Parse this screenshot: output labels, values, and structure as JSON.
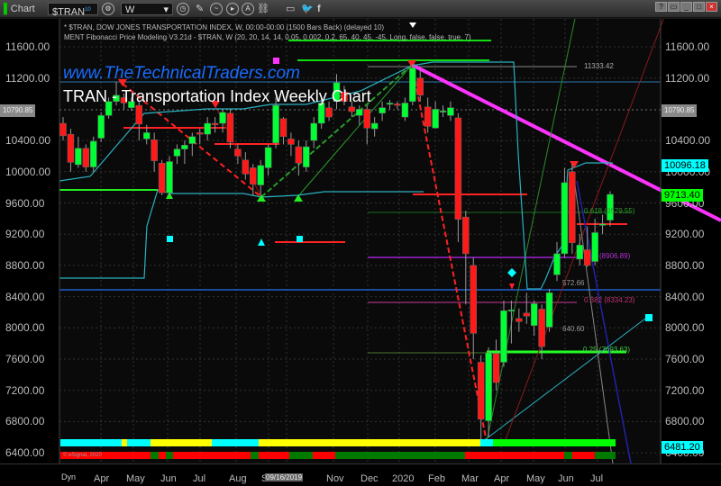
{
  "toolbar": {
    "app_label": "Chart",
    "symbol": "$TRAN",
    "symbol_badge": "10",
    "interval": "W",
    "help": "?"
  },
  "legend": {
    "line1": "* $TRAN, DOW JONES TRANSPORTATION INDEX, W, 00:00-00:00 (1500 Bars Back) (delayed 10)",
    "line2": "MENT Fibonacci Price Modeling V3.21d - $TRAN, W (20, 20, 14, 14, 0.05, 0.002, 0.2, 65, 40, 45, -45, Long, false, false, true, 7)"
  },
  "watermark": "www.TheTechnicalTraders.com",
  "title": "TRAN - Transportation Index Weekly Chart",
  "price_axis": [
    "11600.00",
    "11200.00",
    "10400.00",
    "10000.00",
    "9600.00",
    "9200.00",
    "8800.00",
    "8400.00",
    "8000.00",
    "7600.00",
    "7200.00",
    "6800.00",
    "6400.00"
  ],
  "left_axis": [
    "11600.00",
    "11200.00",
    "10400.00",
    "10000.00",
    "9600.00",
    "9200.00",
    "8800.00",
    "8400.00",
    "8000.00",
    "7600.00",
    "7200.00",
    "6800.00",
    "6400.00"
  ],
  "tags": {
    "last_gray": "10790.85",
    "cyan_high": "10096.18",
    "last_price": "9713.40",
    "cyan_low": "6481.20"
  },
  "annotations": {
    "high": "11333.42",
    "fib618": "0.618 (9579.55)",
    "fib50": "(8906.89)",
    "fib382": "0.382 (8334.23)",
    "fib25": "0.25 (7693.63)",
    "val1": "572.66",
    "val2": "640.60"
  },
  "copyright": "© eSignal, 2020",
  "time_axis": {
    "dyn": "Dyn",
    "months": [
      "Apr",
      "May",
      "Jun",
      "Jul",
      "Aug",
      "S",
      "ct",
      "Nov",
      "Dec",
      "2020",
      "Feb",
      "Mar",
      "Apr",
      "May",
      "Jun",
      "Jul"
    ],
    "cursor_date": "09/16/2019"
  },
  "colors": {
    "up": "#00ff33",
    "down": "#ff1a1a",
    "trend": "#ff33ff",
    "cyan": "#00ffff"
  },
  "chart_data": {
    "type": "candlestick",
    "ylim": [
      6400,
      11700
    ],
    "candles": [
      [
        10620,
        10700,
        10400,
        10460
      ],
      [
        10480,
        10550,
        10000,
        10120
      ],
      [
        10090,
        10450,
        10050,
        10300
      ],
      [
        10300,
        10350,
        10000,
        10060
      ],
      [
        10060,
        10450,
        10000,
        10390
      ],
      [
        10430,
        10760,
        10380,
        10720
      ],
      [
        10720,
        10950,
        10680,
        10900
      ],
      [
        10900,
        11150,
        10850,
        10980
      ],
      [
        10950,
        11000,
        10800,
        10880
      ],
      [
        10820,
        10950,
        10780,
        10900
      ],
      [
        10850,
        10900,
        10400,
        10610
      ],
      [
        10420,
        10600,
        10350,
        10500
      ],
      [
        10410,
        10500,
        10000,
        10140
      ],
      [
        10110,
        10150,
        9700,
        9730
      ],
      [
        9730,
        10200,
        9700,
        10130
      ],
      [
        10200,
        10350,
        10100,
        10290
      ],
      [
        10290,
        10400,
        10100,
        10340
      ],
      [
        10360,
        10500,
        10200,
        10450
      ],
      [
        10500,
        10550,
        10350,
        10480
      ],
      [
        10480,
        10700,
        10400,
        10620
      ],
      [
        10620,
        10700,
        10500,
        10600
      ],
      [
        10620,
        10800,
        10500,
        10760
      ],
      [
        10750,
        10800,
        10300,
        10380
      ],
      [
        10290,
        10350,
        10100,
        10200
      ],
      [
        10150,
        10250,
        9900,
        9970
      ],
      [
        10050,
        10100,
        9700,
        9840
      ],
      [
        9830,
        10150,
        9700,
        10080
      ],
      [
        10050,
        10350,
        9950,
        10310
      ],
      [
        10370,
        10950,
        10300,
        10850
      ],
      [
        10680,
        10700,
        10350,
        10450
      ],
      [
        10420,
        10500,
        10200,
        10350
      ],
      [
        10320,
        10400,
        9950,
        10110
      ],
      [
        10060,
        10400,
        10000,
        10320
      ],
      [
        10400,
        10700,
        10300,
        10620
      ],
      [
        10620,
        10950,
        10550,
        10880
      ],
      [
        10820,
        10900,
        10650,
        10700
      ],
      [
        10900,
        11250,
        10800,
        11140
      ],
      [
        11020,
        11100,
        10850,
        10900
      ],
      [
        10830,
        10900,
        10700,
        10770
      ],
      [
        10720,
        10850,
        10600,
        10800
      ],
      [
        10800,
        10850,
        10350,
        10560
      ],
      [
        10550,
        10700,
        10450,
        10620
      ],
      [
        10750,
        10900,
        10650,
        10820
      ],
      [
        10870,
        10920,
        10800,
        10880
      ],
      [
        10870,
        10900,
        10800,
        10850
      ],
      [
        10700,
        10950,
        10650,
        10880
      ],
      [
        10900,
        11380,
        10850,
        11330
      ],
      [
        11200,
        11300,
        10900,
        10980
      ],
      [
        10830,
        10950,
        10500,
        10580
      ],
      [
        10560,
        10900,
        10550,
        10800
      ],
      [
        10780,
        10850,
        10700,
        10780
      ],
      [
        10720,
        10900,
        10650,
        10820
      ],
      [
        10690,
        10750,
        9100,
        9390
      ],
      [
        9420,
        9500,
        8300,
        8950
      ],
      [
        8800,
        8900,
        7600,
        7930
      ],
      [
        7560,
        7650,
        6500,
        6830
      ],
      [
        6810,
        7750,
        6600,
        7680
      ],
      [
        7670,
        7850,
        7200,
        7300
      ],
      [
        7560,
        8350,
        7500,
        8220
      ],
      [
        8230,
        8350,
        7800,
        8230
      ],
      [
        8120,
        8250,
        7950,
        8080
      ],
      [
        8190,
        8450,
        8050,
        8150
      ],
      [
        8030,
        8350,
        7900,
        8310
      ],
      [
        8240,
        8300,
        7600,
        7760
      ],
      [
        8010,
        8500,
        7950,
        8450
      ],
      [
        8680,
        9100,
        8600,
        8950
      ],
      [
        8950,
        10050,
        8900,
        9860
      ],
      [
        10000,
        10100,
        8950,
        9090
      ],
      [
        8880,
        9200,
        8800,
        9060
      ],
      [
        9000,
        9300,
        8780,
        8800
      ],
      [
        8850,
        9400,
        8800,
        9220
      ],
      [
        9330,
        9450,
        9200,
        9330
      ],
      [
        9380,
        9750,
        9300,
        9710
      ]
    ]
  }
}
